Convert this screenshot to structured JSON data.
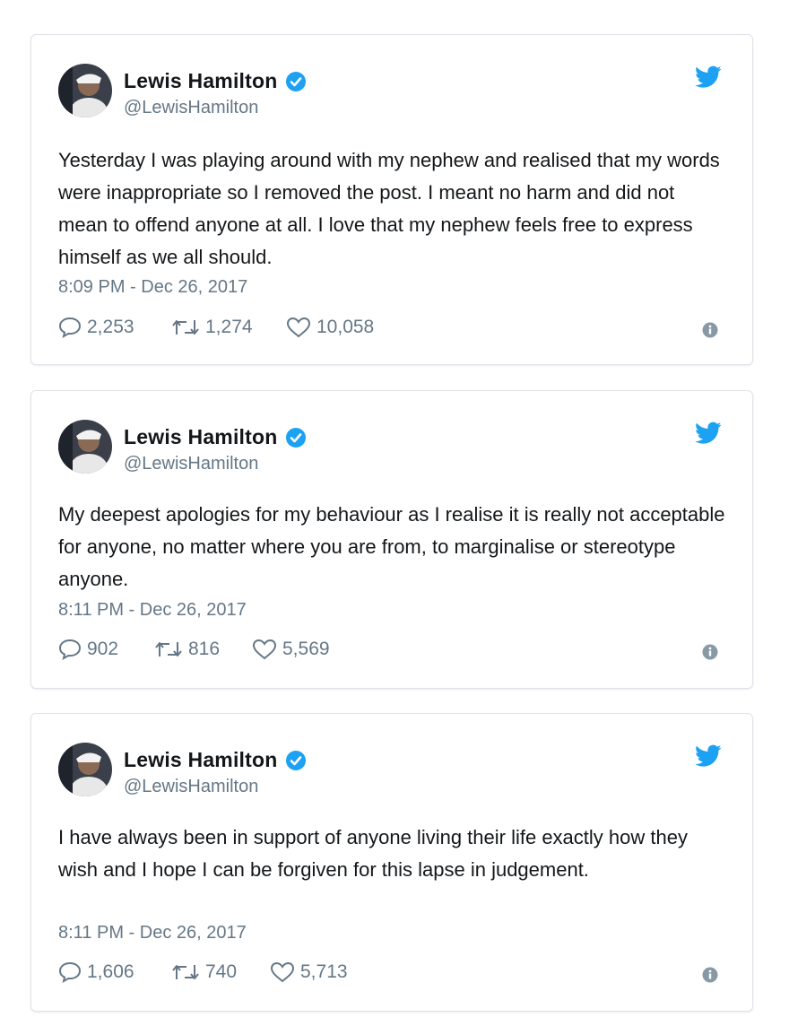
{
  "colors": {
    "accent": "#1da1f2",
    "muted": "#657786",
    "text": "#14171a",
    "border": "#dfe3e8"
  },
  "tweets": [
    {
      "name": "Lewis Hamilton",
      "handle": "@LewisHamilton",
      "text": "Yesterday I was playing around with my nephew and realised that my words were inappropriate so I removed the post. I meant no harm and did not mean to offend anyone at all. I love that my nephew feels free to express himself as we all should.",
      "timestamp": "8:09 PM - Dec 26, 2017",
      "replies": "2,253",
      "retweets": "1,274",
      "likes": "10,058"
    },
    {
      "name": "Lewis Hamilton",
      "handle": "@LewisHamilton",
      "text": "My deepest apologies for my behaviour as I realise it is really not acceptable for anyone, no matter where you are from, to marginalise or stereotype anyone.",
      "timestamp": "8:11 PM - Dec 26, 2017",
      "replies": "902",
      "retweets": "816",
      "likes": "5,569"
    },
    {
      "name": "Lewis Hamilton",
      "handle": "@LewisHamilton",
      "text": "I have always been in support of anyone living their life exactly how they wish and I hope I can be forgiven for this lapse in judgement.",
      "timestamp": "8:11 PM - Dec 26, 2017",
      "replies": "1,606",
      "retweets": "740",
      "likes": "5,713"
    }
  ]
}
